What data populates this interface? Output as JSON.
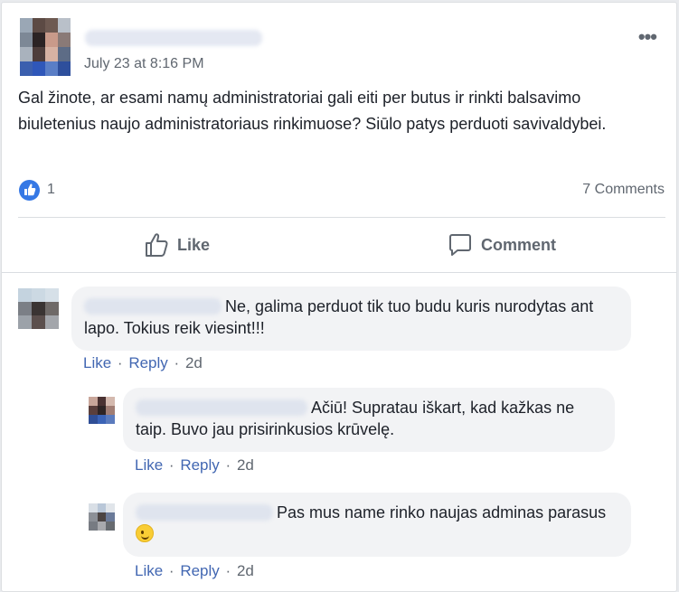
{
  "post": {
    "time": "July 23 at 8:16 PM",
    "text": "Gal žinote, ar esami namų administratoriai gali eiti per butus ir rinkti balsavimo biuletenius naujo administratoriaus rinkimuose? Siūlo patys perduoti savivaldybei.",
    "like_count": "1",
    "comment_count": "7 Comments",
    "more_icon": "more-options-icon"
  },
  "actions": {
    "like_label": "Like",
    "comment_label": "Comment"
  },
  "comments": [
    {
      "text": "Ne, galima perduot tik tuo budu kuris nurodytas ant lapo. Tokius reik viesint!!!",
      "like": "Like",
      "reply": "Reply",
      "age": "2d"
    },
    {
      "text": "Ačiū! Supratau iškart, kad kažkas ne taip. Buvo jau prisirinkusios krūvelę.",
      "like": "Like",
      "reply": "Reply",
      "age": "2d"
    },
    {
      "text": "Pas mus name rinko naujas adminas parasus",
      "emoji": "wink-emoji",
      "like": "Like",
      "reply": "Reply",
      "age": "2d"
    }
  ],
  "colors": {
    "link": "#4267b2",
    "like_bubble": "#3578e5",
    "comment_bg": "#f2f3f5",
    "muted": "#606770"
  }
}
